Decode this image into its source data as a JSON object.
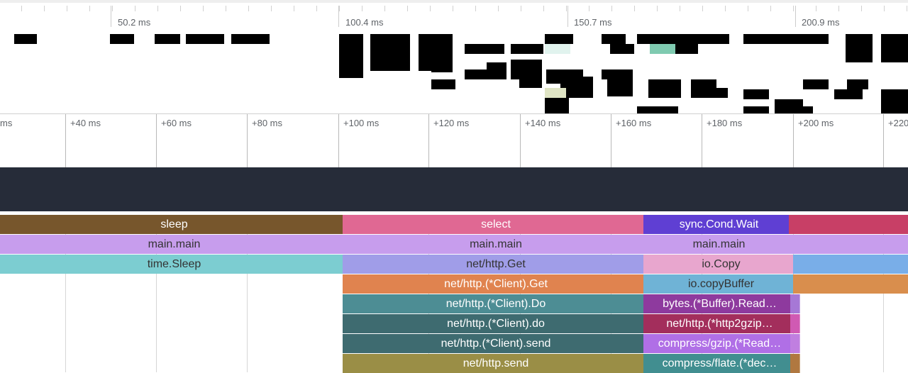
{
  "colors": {
    "track_band": "#262c39",
    "overview_block": "#000000",
    "overview_highlight_mint": "#e1f3ee",
    "overview_highlight_teal": "#7fcab0",
    "overview_highlight_sage": "#dfe4c4"
  },
  "overview": {
    "labels": [
      "50.2 ms",
      "100.4 ms",
      "150.7 ms",
      "200.9 ms"
    ]
  },
  "ruler": {
    "labels": [
      "ms",
      "+40 ms",
      "+60 ms",
      "+80 ms",
      "+100 ms",
      "+120 ms",
      "+140 ms",
      "+160 ms",
      "+180 ms",
      "+200 ms",
      "+220"
    ]
  },
  "flame": {
    "rows": [
      [
        {
          "label": "sleep",
          "bg": "#77562c",
          "fg": "#ffffff"
        },
        {
          "label": "select",
          "bg": "#e06893",
          "fg": "#ffffff"
        },
        {
          "label": "sync.Cond.Wait",
          "bg": "#5f3fd3",
          "fg": "#ffffff"
        },
        {
          "label": "",
          "bg": "#c83f66",
          "fg": "#ffffff"
        }
      ],
      [
        {
          "label": "main.main",
          "bg": "#c79ded",
          "fg": "#333333"
        },
        {
          "label": "main.main",
          "bg": "#c79ded",
          "fg": "#333333"
        },
        {
          "label": "main.main",
          "bg": "#c79ded",
          "fg": "#333333"
        },
        {
          "label": "",
          "bg": "#c79ded",
          "fg": "#333333"
        }
      ],
      [
        {
          "label": "time.Sleep",
          "bg": "#7ccdd1",
          "fg": "#333333"
        },
        {
          "label": "net/http.Get",
          "bg": "#a09de8",
          "fg": "#333333"
        },
        {
          "label": "io.Copy",
          "bg": "#e8a6ce",
          "fg": "#333333"
        },
        {
          "label": "",
          "bg": "#79aee8",
          "fg": "#333333"
        }
      ],
      [
        {
          "label": "net/http.(*Client).Get",
          "bg": "#e0834f",
          "fg": "#ffffff"
        },
        {
          "label": "io.copyBuffer",
          "bg": "#6fb3d6",
          "fg": "#333333"
        },
        {
          "label": "",
          "bg": "#d98e4d",
          "fg": "#ffffff"
        }
      ],
      [
        {
          "label": "net/http.(*Client).Do",
          "bg": "#4d8d94",
          "fg": "#ffffff"
        },
        {
          "label": "bytes.(*Buffer).Read…",
          "bg": "#8e3a9e",
          "fg": "#ffffff"
        },
        {
          "label": "",
          "bg": "#a678d6",
          "fg": "#ffffff"
        }
      ],
      [
        {
          "label": "net/http.(*Client).do",
          "bg": "#3e6b70",
          "fg": "#ffffff"
        },
        {
          "label": "net/http.(*http2gzip…",
          "bg": "#a32e5c",
          "fg": "#ffffff"
        },
        {
          "label": "",
          "bg": "#d05ab3",
          "fg": "#ffffff"
        }
      ],
      [
        {
          "label": "net/http.(*Client).send",
          "bg": "#3e6b70",
          "fg": "#ffffff"
        },
        {
          "label": "compress/gzip.(*Read…",
          "bg": "#b06fe6",
          "fg": "#ffffff"
        },
        {
          "label": "",
          "bg": "#c07fe0",
          "fg": "#ffffff"
        }
      ],
      [
        {
          "label": "net/http.send",
          "bg": "#9a8e46",
          "fg": "#ffffff"
        },
        {
          "label": "compress/flate.(*dec…",
          "bg": "#418e90",
          "fg": "#ffffff"
        },
        {
          "label": "",
          "bg": "#b07840",
          "fg": "#ffffff"
        }
      ]
    ]
  }
}
